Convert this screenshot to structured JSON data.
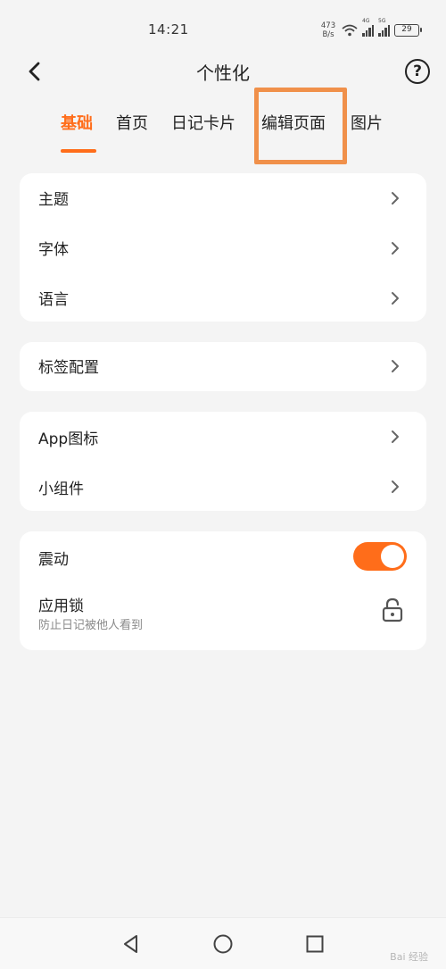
{
  "status_bar": {
    "time": "14:21",
    "net_speed_value": "473",
    "net_speed_unit": "B/s",
    "sim1_gen": "4G",
    "sim2_gen": "5G",
    "battery": "29"
  },
  "nav": {
    "title": "个性化",
    "back_icon": "chevron-left-icon",
    "help_label": "?"
  },
  "tabs": [
    {
      "label": "基础",
      "active": true
    },
    {
      "label": "首页",
      "active": false
    },
    {
      "label": "日记卡片",
      "active": false
    },
    {
      "label": "编辑页面",
      "active": false
    },
    {
      "label": "图片",
      "active": false
    }
  ],
  "groups": {
    "appearance": [
      "主题",
      "字体",
      "语言"
    ],
    "tags": [
      "标签配置"
    ],
    "widgets": [
      "App图标",
      "小组件"
    ],
    "system": {
      "vibration_label": "震动",
      "vibration_on": true,
      "app_lock_label": "应用锁",
      "app_lock_desc": "防止日记被他人看到"
    }
  },
  "watermark": "Bai 经验",
  "colors": {
    "accent": "#ff6d1a",
    "highlight": "#f0904a",
    "background": "#f4f4f4",
    "card": "#ffffff"
  }
}
